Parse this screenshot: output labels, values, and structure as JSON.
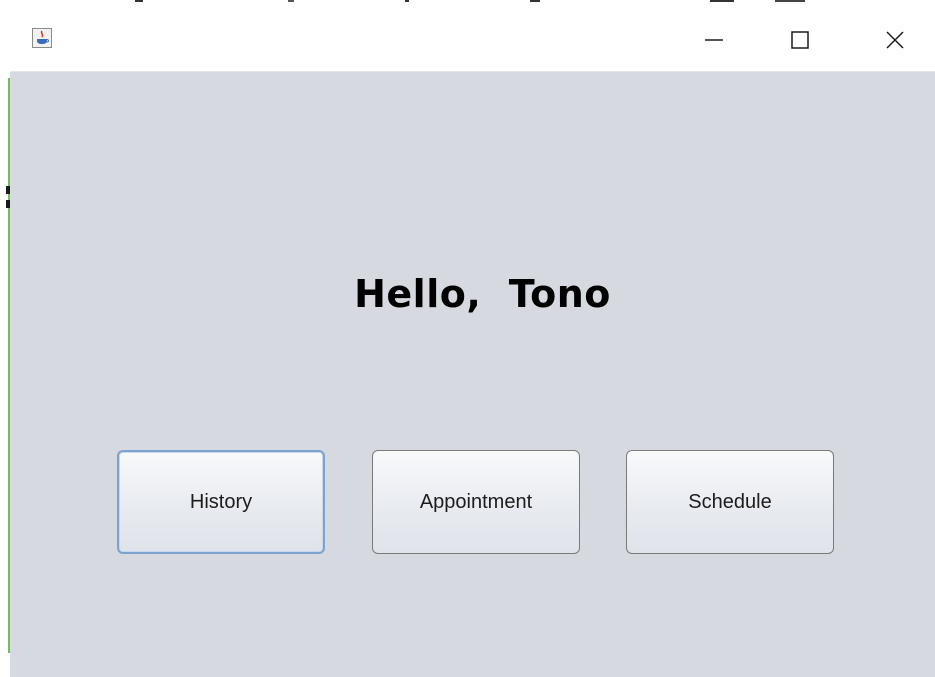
{
  "window": {
    "title": "",
    "controls": {
      "minimize_icon": "minimize-icon",
      "maximize_icon": "maximize-icon",
      "close_icon": "close-icon"
    }
  },
  "main": {
    "greeting": "Hello,  Tono",
    "buttons": {
      "history": "History",
      "appointment": "Appointment",
      "schedule": "Schedule"
    }
  },
  "colors": {
    "content_background": "#d6d9e0",
    "titlebar_background": "#ffffff",
    "focus_border": "#7da2ce"
  }
}
